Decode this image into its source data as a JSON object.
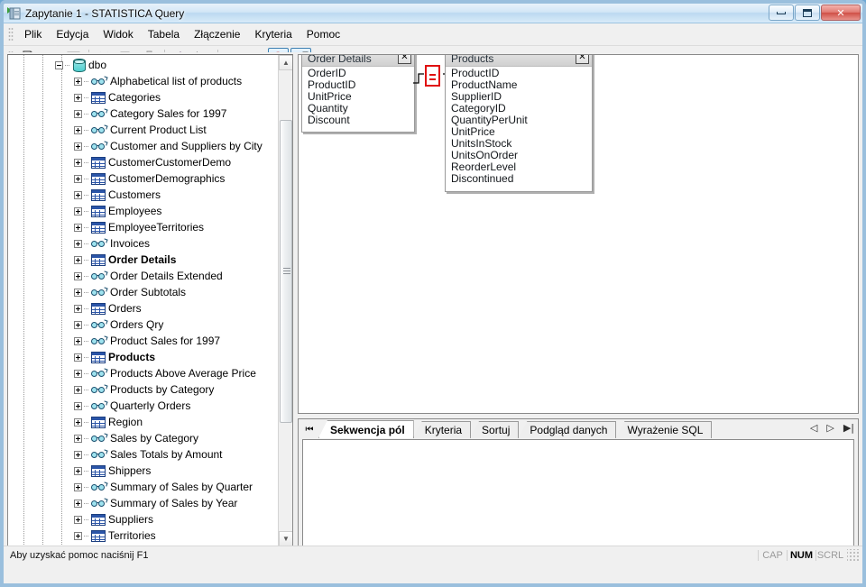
{
  "window": {
    "title": "Zapytanie 1 - STATISTICA Query",
    "icon": "query-window-icon",
    "minimize_label": "—",
    "maximize_label": "□",
    "close_label": "✕"
  },
  "menubar": {
    "items": [
      {
        "label": "Plik",
        "name": "menu-plik"
      },
      {
        "label": "Edycja",
        "name": "menu-edycja"
      },
      {
        "label": "Widok",
        "name": "menu-widok"
      },
      {
        "label": "Tabela",
        "name": "menu-tabela"
      },
      {
        "label": "Złączenie",
        "name": "menu-zlaczenie"
      },
      {
        "label": "Kryteria",
        "name": "menu-kryteria"
      },
      {
        "label": "Pomoc",
        "name": "menu-pomoc"
      }
    ]
  },
  "toolbar": {
    "buttons": [
      {
        "icon": "new-document-icon",
        "enabled": true,
        "active": false
      },
      {
        "icon": "open-folder-icon",
        "enabled": true,
        "active": false
      },
      {
        "icon": "save-disk-icon",
        "enabled": false,
        "active": false
      },
      {
        "sep": true
      },
      {
        "icon": "cut-scissors-icon",
        "enabled": false,
        "active": false
      },
      {
        "icon": "copy-icon",
        "enabled": false,
        "active": false
      },
      {
        "icon": "paste-clipboard-icon",
        "enabled": false,
        "active": false
      },
      {
        "sep": true
      },
      {
        "icon": "book-help-icon",
        "enabled": true,
        "active": false
      },
      {
        "icon": "help-pointer-icon",
        "enabled": true,
        "active": false
      },
      {
        "sep": true
      },
      {
        "icon": "exclamation-icon",
        "enabled": false,
        "active": false
      },
      {
        "icon": "exclamation-plus-icon",
        "enabled": false,
        "active": false
      },
      {
        "icon": "refresh-warning-icon",
        "enabled": true,
        "active": true
      },
      {
        "icon": "show-diagram-icon",
        "enabled": true,
        "active": true
      },
      {
        "icon": "run-play-icon",
        "enabled": false,
        "active": false
      }
    ]
  },
  "tree": {
    "root": {
      "label": "dbo",
      "icon": "database-icon",
      "expanded": true
    },
    "items": [
      {
        "label": "Alphabetical list of products",
        "icon": "view-icon",
        "bold": false
      },
      {
        "label": "Categories",
        "icon": "table-icon",
        "bold": false
      },
      {
        "label": "Category Sales for 1997",
        "icon": "view-icon",
        "bold": false
      },
      {
        "label": "Current Product List",
        "icon": "view-icon",
        "bold": false
      },
      {
        "label": "Customer and Suppliers by City",
        "icon": "view-icon",
        "bold": false
      },
      {
        "label": "CustomerCustomerDemo",
        "icon": "table-icon",
        "bold": false
      },
      {
        "label": "CustomerDemographics",
        "icon": "table-icon",
        "bold": false
      },
      {
        "label": "Customers",
        "icon": "table-icon",
        "bold": false
      },
      {
        "label": "Employees",
        "icon": "table-icon",
        "bold": false
      },
      {
        "label": "EmployeeTerritories",
        "icon": "table-icon",
        "bold": false
      },
      {
        "label": "Invoices",
        "icon": "view-icon",
        "bold": false
      },
      {
        "label": "Order Details",
        "icon": "table-icon",
        "bold": true
      },
      {
        "label": "Order Details Extended",
        "icon": "view-icon",
        "bold": false
      },
      {
        "label": "Order Subtotals",
        "icon": "view-icon",
        "bold": false
      },
      {
        "label": "Orders",
        "icon": "table-icon",
        "bold": false
      },
      {
        "label": "Orders Qry",
        "icon": "view-icon",
        "bold": false
      },
      {
        "label": "Product Sales for 1997",
        "icon": "view-icon",
        "bold": false
      },
      {
        "label": "Products",
        "icon": "table-icon",
        "bold": true
      },
      {
        "label": "Products Above Average Price",
        "icon": "view-icon",
        "bold": false
      },
      {
        "label": "Products by Category",
        "icon": "view-icon",
        "bold": false
      },
      {
        "label": "Quarterly Orders",
        "icon": "view-icon",
        "bold": false
      },
      {
        "label": "Region",
        "icon": "table-icon",
        "bold": false
      },
      {
        "label": "Sales by Category",
        "icon": "view-icon",
        "bold": false
      },
      {
        "label": "Sales Totals by Amount",
        "icon": "view-icon",
        "bold": false
      },
      {
        "label": "Shippers",
        "icon": "table-icon",
        "bold": false
      },
      {
        "label": "Summary of Sales by Quarter",
        "icon": "view-icon",
        "bold": false
      },
      {
        "label": "Summary of Sales by Year",
        "icon": "view-icon",
        "bold": false
      },
      {
        "label": "Suppliers",
        "icon": "table-icon",
        "bold": false
      },
      {
        "label": "Territories",
        "icon": "table-icon",
        "bold": false
      }
    ]
  },
  "diagram": {
    "tables": [
      {
        "name": "Order Details",
        "close_label": "✕",
        "fields": [
          "OrderID",
          "ProductID",
          "UnitPrice",
          "Quantity",
          "Discount"
        ]
      },
      {
        "name": "Products",
        "close_label": "✕",
        "fields": [
          "ProductID",
          "ProductName",
          "SupplierID",
          "CategoryID",
          "QuantityPerUnit",
          "UnitPrice",
          "UnitsInStock",
          "UnitsOnOrder",
          "ReorderLevel",
          "Discontinued"
        ]
      }
    ],
    "join": {
      "operator": "=",
      "left_table": "Order Details",
      "left_field": "ProductID",
      "right_table": "Products",
      "right_field": "ProductID",
      "color": "#e01010"
    }
  },
  "bottom": {
    "first_button_label": "⏮",
    "tabs": [
      {
        "label": "Sekwencja pól",
        "active": true,
        "name": "tab-sekwencja-pol"
      },
      {
        "label": "Kryteria",
        "active": false,
        "name": "tab-kryteria"
      },
      {
        "label": "Sortuj",
        "active": false,
        "name": "tab-sortuj"
      },
      {
        "label": "Podgląd danych",
        "active": false,
        "name": "tab-podglad-danych"
      },
      {
        "label": "Wyrażenie SQL",
        "active": false,
        "name": "tab-wyrazenie-sql"
      }
    ],
    "nav": {
      "prev_label": "◁",
      "next_label": "▷",
      "last_label": "▶|"
    }
  },
  "statusbar": {
    "message": "Aby uzyskać pomoc naciśnij F1",
    "indicators": [
      {
        "label": "CAP",
        "on": false
      },
      {
        "label": "NUM",
        "on": true
      },
      {
        "label": "SCRL",
        "on": false
      }
    ]
  },
  "colors": {
    "accent": "#3c7fb1",
    "join_red": "#e01010",
    "table_icon": "#2b55a8",
    "view_icon": "#9fe3ef",
    "db_icon": "#4ecfcf"
  }
}
